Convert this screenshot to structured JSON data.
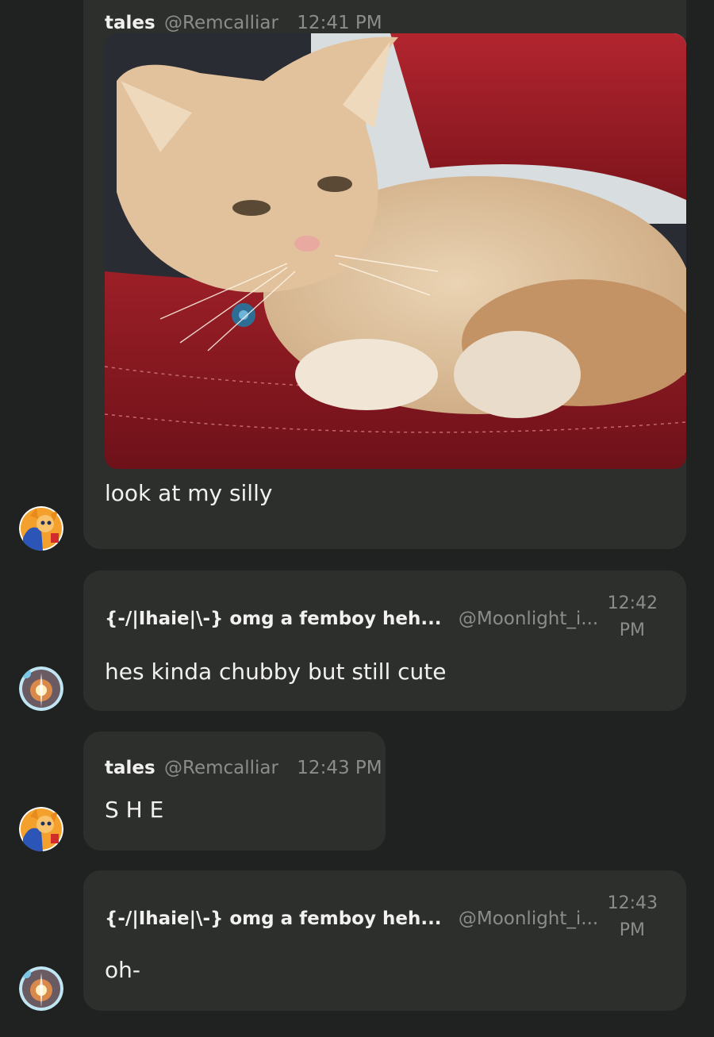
{
  "messages": [
    {
      "author": "tales",
      "handle": "@Remcalliar",
      "time": "12:41 PM",
      "text": "look at my silly",
      "has_image": true
    },
    {
      "author": "{-/|Ihaie|\\-} omg a femboy heh...",
      "handle": "@Moonlight_i...",
      "time_line1": "12:42",
      "time_line2": "PM",
      "text": "hes kinda chubby but still cute"
    },
    {
      "author": "tales",
      "handle": "@Remcalliar",
      "time": "12:43 PM",
      "text": "S H E"
    },
    {
      "author": "{-/|Ihaie|\\-} omg a femboy heh...",
      "handle": "@Moonlight_i...",
      "time_line1": "12:43",
      "time_line2": "PM",
      "text": "oh-"
    }
  ],
  "colors": {
    "background": "#1f2220",
    "bubble": "#2d2f2d",
    "text": "#f1f1ef",
    "muted": "#8b8d89"
  }
}
